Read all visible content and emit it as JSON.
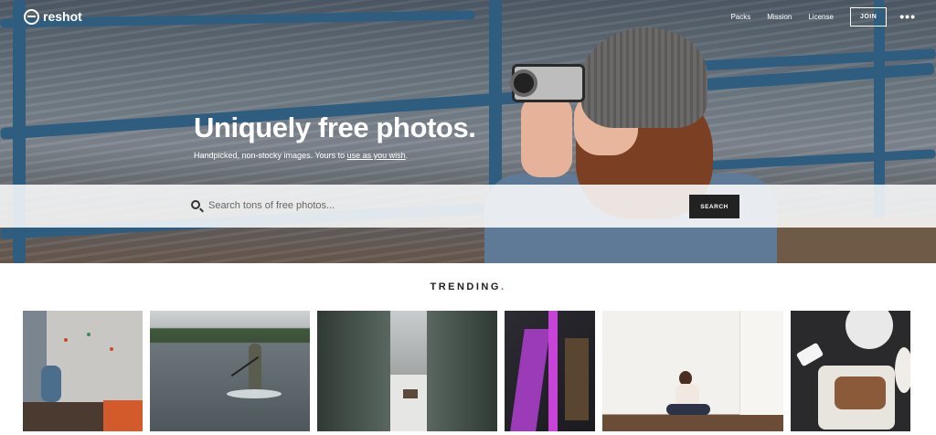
{
  "brand": {
    "name": "reshot"
  },
  "nav": {
    "items": [
      "Packs",
      "Mission",
      "License"
    ],
    "join_label": "JOIN",
    "more_label": "•••"
  },
  "hero": {
    "headline": "Uniquely free photos.",
    "tagline_prefix": "Handpicked, non-stocky images. Yours to ",
    "tagline_link": "use as you wish",
    "tagline_suffix": "."
  },
  "search": {
    "placeholder": "Search tons of free photos...",
    "button_label": "SEARCH"
  },
  "trending": {
    "title": "TRENDING",
    "accent_dot": "."
  },
  "colors": {
    "accent": "#e0432b",
    "search_button": "#222222"
  },
  "icons": {
    "logo": "reshot-logo-icon",
    "search": "search-icon",
    "more": "more-dots-icon"
  }
}
